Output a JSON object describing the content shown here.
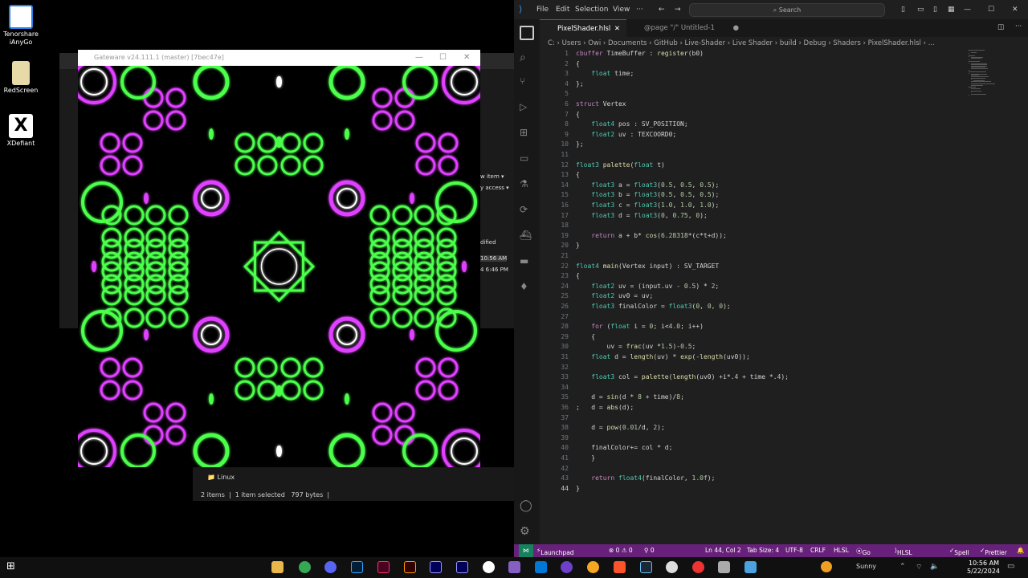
{
  "desktop": {
    "icons": [
      {
        "label": "Tenorshare iAnyGo",
        "color": "#2a7de1"
      },
      {
        "label": "RedScreen",
        "color": "#e8d9a8"
      },
      {
        "label": "XDefiant",
        "color": "#f0f0f0"
      }
    ]
  },
  "explorer_bg": {
    "items": [
      "w item ▾",
      "y access ▾",
      "dified",
      "10:56 AM",
      "4 6:46 PM"
    ],
    "folder_label": "Linux",
    "status": {
      "count": "2 items",
      "selected": "1 item selected",
      "size": "797 bytes"
    }
  },
  "gateware": {
    "title": "Gateware v24.111.1 (master) [7bec47e]",
    "controls": {
      "min": "—",
      "max": "☐",
      "close": "✕"
    },
    "colors": {
      "green": "#4cff4c",
      "magenta": "#e040ff",
      "white": "#ffffff"
    }
  },
  "vscode": {
    "menu": [
      "File",
      "Edit",
      "Selection",
      "View",
      "···"
    ],
    "search_placeholder": "Search",
    "tabs": [
      {
        "label": "PixelShader.hlsl",
        "close": "✕"
      },
      {
        "label": "@page \"/\" Untitled-1",
        "dot": "●"
      }
    ],
    "breadcrumb": "C: › Users › Owi › Documents › GitHub › Live-Shader › Live Shader › build › Debug › Shaders › PixelShader.hlsl › ...",
    "code": [
      "cbuffer TimeBuffer : register(b0)",
      "{",
      "    float time;",
      "};",
      "",
      "struct Vertex",
      "{",
      "    float4 pos : SV_POSITION;",
      "    float2 uv : TEXCOORD0;",
      "};",
      "",
      "float3 palette(float t)",
      "{",
      "    float3 a = float3(0.5, 0.5, 0.5);",
      "    float3 b = float3(0.5, 0.5, 0.5);",
      "    float3 c = float3(1.0, 1.0, 1.0);",
      "    float3 d = float3(0, 0.75, 0);",
      "",
      "    return a + b* cos(6.28318*(c*t+d));",
      "}",
      "",
      "float4 main(Vertex input) : SV_TARGET",
      "{",
      "    float2 uv = (input.uv - 0.5) * 2;",
      "    float2 uv0 = uv;",
      "    float3 finalColor = float3(0, 0, 0);",
      "",
      "    for (float i = 0; i<4.0; i++)",
      "    {",
      "        uv = frac(uv *1.5)-0.5;",
      "    float d = length(uv) * exp(-length(uv0));",
      "",
      "    float3 col = palette(length(uv0) +i*.4 + time *.4);",
      "",
      "    d = sin(d * 8 + time)/8;",
      ";   d = abs(d);",
      "",
      "    d = pow(0.01/d, 2);",
      "",
      "    finalColor+= col * d;",
      "    }",
      "",
      "    return float4(finalColor, 1.0f);",
      "}"
    ],
    "status": {
      "remote": "⋈",
      "launchpad": "Launchpad",
      "problems": "⊗ 0 ⚠ 0",
      "ports": "⚲ 0",
      "position": "Ln 44, Col 2",
      "tab_size": "Tab Size: 4",
      "encoding": "UTF-8",
      "eol": "CRLF",
      "language": "HLSL",
      "golive": "Go Live",
      "hlsl_tools": "HLSL Tools",
      "spell": "Spell",
      "prettier": "Prettier"
    }
  },
  "taskbar": {
    "weather": "Sunny",
    "time": "10:56 AM",
    "date": "5/22/2024"
  }
}
